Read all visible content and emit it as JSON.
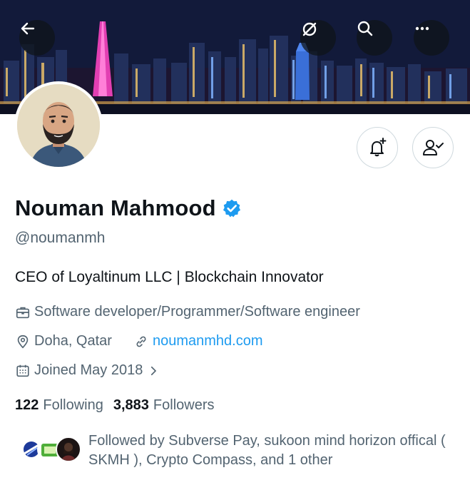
{
  "header": {
    "back_icon": "arrow-left-icon",
    "grok_icon": "slash-circle-icon",
    "search_icon": "search-icon",
    "more_icon": "more-horizontal-icon"
  },
  "profile": {
    "name": "Nouman Mahmood",
    "handle": "@noumanmh",
    "bio": "CEO of Loyaltinum LLC | Blockchain Innovator",
    "profession": "Software developer/Programmer/Software engineer",
    "location": "Doha, Qatar",
    "website": "noumanmhd.com",
    "joined": "Joined May 2018",
    "following_count": "122",
    "following_label": "Following",
    "followers_count": "3,883",
    "followers_label": "Followers",
    "followed_by": "Followed by Subverse Pay, sukoon mind horizon offical ( SKMH ), Crypto Compass, and 1 other"
  },
  "colors": {
    "accent": "#1d9bf0",
    "text": "#0f1419",
    "secondary": "#536471",
    "border": "#cfd9de"
  }
}
